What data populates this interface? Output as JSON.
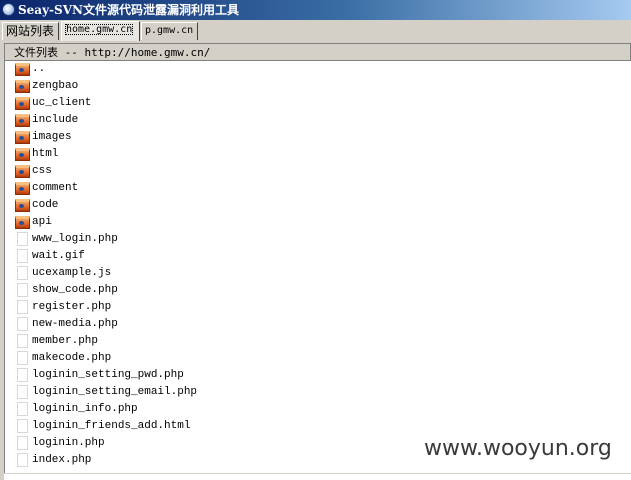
{
  "window": {
    "title": "Seay-SVN文件源代码泄露漏洞利用工具",
    "icon": "app-icon"
  },
  "tabs": [
    {
      "label": "网站列表",
      "active": false
    },
    {
      "label": "home.gmw.cn",
      "active": true
    },
    {
      "label": "p.gmw.cn",
      "active": false
    }
  ],
  "file_panel": {
    "header": "文件列表 -- http://home.gmw.cn/",
    "items": [
      {
        "name": "..",
        "type": "folder"
      },
      {
        "name": "zengbao",
        "type": "folder"
      },
      {
        "name": "uc_client",
        "type": "folder"
      },
      {
        "name": "include",
        "type": "folder"
      },
      {
        "name": "images",
        "type": "folder"
      },
      {
        "name": "html",
        "type": "folder"
      },
      {
        "name": "css",
        "type": "folder"
      },
      {
        "name": "comment",
        "type": "folder"
      },
      {
        "name": "code",
        "type": "folder"
      },
      {
        "name": "api",
        "type": "folder"
      },
      {
        "name": "www_login.php",
        "type": "file"
      },
      {
        "name": "wait.gif",
        "type": "file"
      },
      {
        "name": "ucexample.js",
        "type": "file"
      },
      {
        "name": "show_code.php",
        "type": "file"
      },
      {
        "name": "register.php",
        "type": "file"
      },
      {
        "name": "new-media.php",
        "type": "file"
      },
      {
        "name": "member.php",
        "type": "file"
      },
      {
        "name": "makecode.php",
        "type": "file"
      },
      {
        "name": "loginin_setting_pwd.php",
        "type": "file"
      },
      {
        "name": "loginin_setting_email.php",
        "type": "file"
      },
      {
        "name": "loginin_info.php",
        "type": "file"
      },
      {
        "name": "loginin_friends_add.html",
        "type": "file"
      },
      {
        "name": "loginin.php",
        "type": "file"
      },
      {
        "name": "index.php",
        "type": "file"
      }
    ]
  },
  "watermark": "www.wooyun.org",
  "colors": {
    "titlebar_start": "#0a246a",
    "titlebar_end": "#a6caf0",
    "window_bg": "#d4d0c8",
    "folder_icon": "#e06020"
  }
}
